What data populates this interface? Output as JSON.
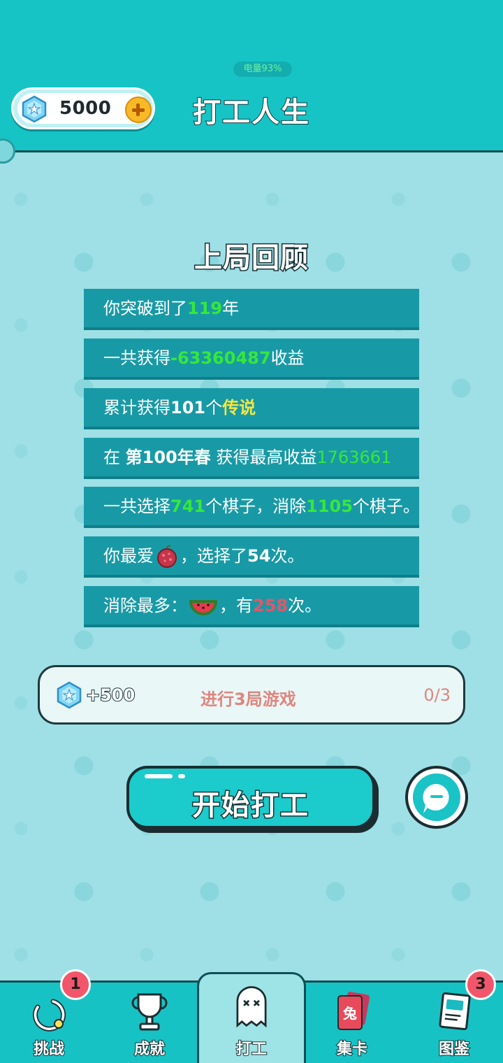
{
  "header": {
    "battery": "电量93%",
    "coins": "5000",
    "title": "打工人生"
  },
  "review": {
    "title": "上局回顾",
    "rows": [
      {
        "parts": [
          "你突破到了",
          "119",
          "年"
        ]
      },
      {
        "parts": [
          "一共获得",
          "-63360487",
          "收益"
        ]
      },
      {
        "parts": [
          "累计获得",
          "101",
          "个",
          "传说"
        ]
      },
      {
        "parts": [
          "在 ",
          "第100年春",
          " 获得最高收益",
          "1763661"
        ]
      },
      {
        "parts": [
          "一共选择",
          "741",
          "个棋子，消除",
          "1105",
          "个棋子。"
        ]
      },
      {
        "parts": [
          "你最爱",
          "，选择了",
          "54",
          "次。"
        ],
        "fruit": "lychee"
      },
      {
        "parts": [
          "消除最多：",
          "，有",
          "258",
          "次。"
        ],
        "fruit": "watermelon"
      }
    ]
  },
  "task": {
    "reward": "+500",
    "description": "进行3局游戏",
    "progress": "0/3"
  },
  "start_button": "开始打工",
  "nav": {
    "items": [
      {
        "label": "挑战",
        "icon": "challenge-ring-icon",
        "badge": "1"
      },
      {
        "label": "成就",
        "icon": "trophy-icon"
      },
      {
        "label": "打工",
        "icon": "ghost-icon",
        "active": true
      },
      {
        "label": "集卡",
        "icon": "rabbit-card-icon",
        "card_char": "兔"
      },
      {
        "label": "图鉴",
        "icon": "book-icon",
        "badge": "3"
      }
    ]
  },
  "colors": {
    "header": "#16c4c6",
    "row": "#189aa6",
    "highlight_green": "#35e83a",
    "highlight_yellow": "#f7e640",
    "highlight_red": "#e2566a"
  }
}
